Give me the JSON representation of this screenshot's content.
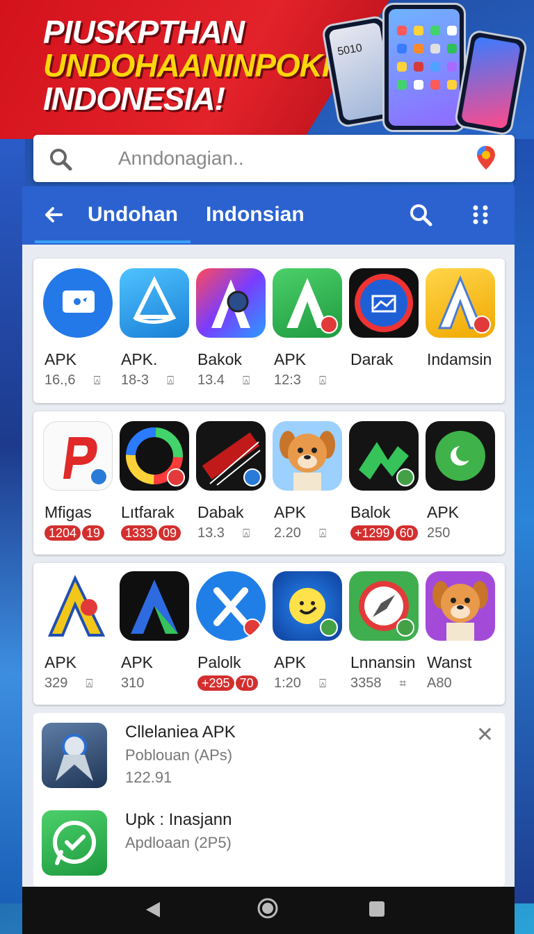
{
  "banner": {
    "line1": "PIUSKPTHAN",
    "line2": "UNDOHAANINPOKIO",
    "line3": "INDONESIA!",
    "phone_time": "5010"
  },
  "search": {
    "placeholder": "Anndonagian.."
  },
  "appbar": {
    "tab1": "Undohan",
    "tab2": "Indonsian"
  },
  "rows": [
    [
      {
        "name": "APK",
        "meta": "16.,6",
        "dl": "⍓",
        "icon": "chat-bubble-icon"
      },
      {
        "name": "APK.",
        "meta": "18-3",
        "dl": "⍓",
        "icon": "sail-icon"
      },
      {
        "name": "Bakok",
        "meta": "13.4",
        "dl": "⍓",
        "icon": "letter-a-hand-icon"
      },
      {
        "name": "APK",
        "meta": "12:3",
        "dl": "⍓",
        "icon": "letter-a-green-icon"
      },
      {
        "name": "Darak",
        "meta": "",
        "dl": "",
        "icon": "chart-circle-icon"
      },
      {
        "name": "Indamsin",
        "meta": "",
        "dl": "",
        "icon": "letter-a-yellow-icon"
      }
    ],
    [
      {
        "name": "Mfigas",
        "pills": [
          "1204",
          "19"
        ],
        "icon": "letter-p-icon"
      },
      {
        "name": "Lıtfarak",
        "pills": [
          "1333",
          "09"
        ],
        "icon": "colorwheel-icon"
      },
      {
        "name": "Dabak",
        "meta": "13.3",
        "dl": "⍓",
        "icon": "topa-icon"
      },
      {
        "name": "APK",
        "meta": "2.20",
        "dl": "⍓",
        "icon": "dog-icon"
      },
      {
        "name": "Balok",
        "pills": [
          "+1299",
          "60"
        ],
        "icon": "arrow-green-icon"
      },
      {
        "name": "APK",
        "meta": "250",
        "dl": "",
        "icon": "moon-badge-icon"
      }
    ],
    [
      {
        "name": "APK",
        "meta": "329",
        "dl": "⍓",
        "icon": "letter-a-rainbow-icon"
      },
      {
        "name": "APK",
        "meta": "310",
        "dl": "",
        "icon": "letter-a-blue-icon"
      },
      {
        "name": "Palolk",
        "pills": [
          "+295",
          "70"
        ],
        "icon": "letter-x-icon"
      },
      {
        "name": "APK",
        "meta": "1:20",
        "dl": "⍓",
        "icon": "sun-face-icon"
      },
      {
        "name": "Lnnansin",
        "meta": "3358",
        "dl": "⌗",
        "icon": "compass-icon"
      },
      {
        "name": "Wanst",
        "meta": "A80",
        "dl": "",
        "icon": "dog-icon"
      }
    ]
  ],
  "updates": [
    {
      "title": "Cllelaniea APK",
      "sub": "Poblouan (APs)",
      "num": "122.91",
      "icon": "compass-silver-icon"
    },
    {
      "title": "Upk : Inasjann",
      "sub": "Apdloaan (2P5)",
      "num": "",
      "icon": "whatsapp-icon"
    }
  ],
  "colors": {
    "accent": "#2b62cf",
    "banner_red": "#d3121c",
    "pill_red": "#d32f2f"
  }
}
